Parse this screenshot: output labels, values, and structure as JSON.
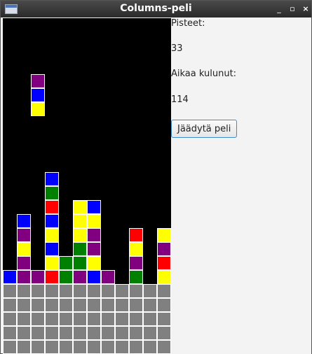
{
  "window": {
    "title": "Columns-peli"
  },
  "colors": {
    "purple": "#800080",
    "blue": "#0000ff",
    "yellow": "#ffff00",
    "red": "#ff0000",
    "green": "#008000",
    "gray": "#808080"
  },
  "panel": {
    "score_label": "Pisteet:",
    "score_value": "33",
    "time_label": "Aikaa kulunut:",
    "time_value": "114",
    "freeze_button": "Jäädytä peli"
  },
  "board": {
    "columns": 12,
    "rows": 24,
    "falling_piece": {
      "col": 2,
      "top_row": 4,
      "colors": [
        "purple",
        "blue",
        "yellow"
      ]
    },
    "stacks": [
      [
        "blue"
      ],
      [
        "purple",
        "purple",
        "yellow",
        "purple",
        "blue"
      ],
      [
        "purple"
      ],
      [
        "red",
        "yellow",
        "blue",
        "yellow",
        "blue",
        "red",
        "green",
        "blue"
      ],
      [
        "green",
        "green"
      ],
      [
        "purple",
        "green",
        "green",
        "yellow",
        "yellow",
        "yellow"
      ],
      [
        "blue",
        "yellow",
        "purple",
        "purple",
        "yellow",
        "blue"
      ],
      [
        "purple"
      ],
      [],
      [
        "green",
        "purple",
        "yellow",
        "red"
      ],
      [],
      [
        "yellow",
        "red",
        "purple",
        "yellow"
      ]
    ],
    "gray_rows": 5
  }
}
